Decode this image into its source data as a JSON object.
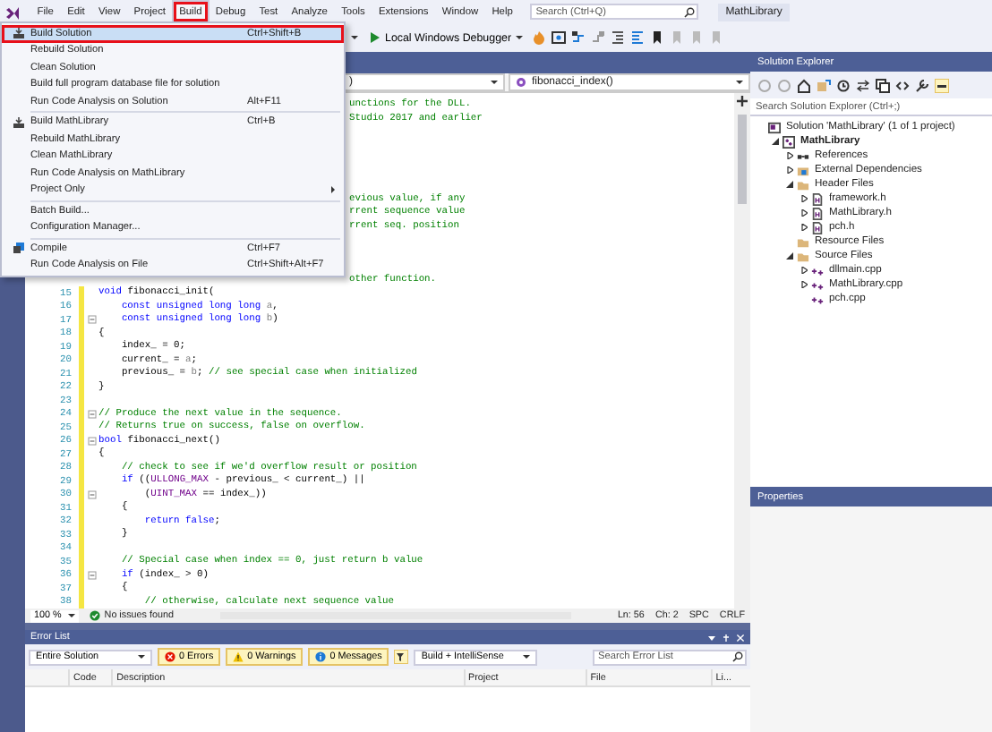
{
  "menu_bar": {
    "items": [
      {
        "label": "File",
        "selected": false,
        "highlighted": false
      },
      {
        "label": "Edit",
        "selected": false,
        "highlighted": false
      },
      {
        "label": "View",
        "selected": false,
        "highlighted": false
      },
      {
        "label": "Project",
        "selected": false,
        "highlighted": false
      },
      {
        "label": "Build",
        "selected": true,
        "highlighted": true
      },
      {
        "label": "Debug",
        "selected": false,
        "highlighted": false
      },
      {
        "label": "Test",
        "selected": false,
        "highlighted": false
      },
      {
        "label": "Analyze",
        "selected": false,
        "highlighted": false
      },
      {
        "label": "Tools",
        "selected": false,
        "highlighted": false
      },
      {
        "label": "Extensions",
        "selected": false,
        "highlighted": false
      },
      {
        "label": "Window",
        "selected": false,
        "highlighted": false
      },
      {
        "label": "Help",
        "selected": false,
        "highlighted": false
      }
    ],
    "search": {
      "placeholder": "Search (Ctrl+Q)"
    },
    "solution_name": "MathLibrary"
  },
  "toolbar": {
    "debugger": "Local Windows Debugger"
  },
  "build_menu": {
    "groups": [
      [
        {
          "kind": "build",
          "label": "Build Solution",
          "shortcut": "Ctrl+Shift+B",
          "selected": true,
          "highlighted": true,
          "submenu": false
        },
        {
          "kind": "plain",
          "label": "Rebuild Solution",
          "selected": false,
          "highlighted": false,
          "submenu": false
        },
        {
          "kind": "plain",
          "label": "Clean Solution",
          "selected": false,
          "highlighted": false,
          "submenu": false
        },
        {
          "kind": "plain",
          "label": "Build full program database file for solution",
          "selected": false,
          "highlighted": false,
          "submenu": false
        },
        {
          "kind": "plain",
          "label": "Run Code Analysis on Solution",
          "shortcut": "Alt+F11",
          "selected": false,
          "highlighted": false,
          "submenu": false
        }
      ],
      [
        {
          "kind": "build",
          "label": "Build MathLibrary",
          "shortcut": "Ctrl+B",
          "selected": false,
          "highlighted": false,
          "submenu": false
        },
        {
          "kind": "plain",
          "label": "Rebuild MathLibrary",
          "selected": false,
          "highlighted": false,
          "submenu": false
        },
        {
          "kind": "plain",
          "label": "Clean MathLibrary",
          "selected": false,
          "highlighted": false,
          "submenu": false
        },
        {
          "kind": "plain",
          "label": "Run Code Analysis on MathLibrary",
          "selected": false,
          "highlighted": false,
          "submenu": false
        },
        {
          "kind": "plain",
          "label": "Project Only",
          "selected": false,
          "highlighted": false,
          "submenu": true
        }
      ],
      [
        {
          "kind": "plain",
          "label": "Batch Build...",
          "selected": false,
          "highlighted": false,
          "submenu": false
        },
        {
          "kind": "plain",
          "label": "Configuration Manager...",
          "selected": false,
          "highlighted": false,
          "submenu": false
        }
      ],
      [
        {
          "kind": "compile",
          "label": "Compile",
          "shortcut": "Ctrl+F7",
          "selected": false,
          "highlighted": false,
          "submenu": false
        },
        {
          "kind": "plain",
          "label": "Run Code Analysis on File",
          "shortcut": "Ctrl+Shift+Alt+F7",
          "selected": false,
          "highlighted": false,
          "submenu": false
        }
      ]
    ]
  },
  "editor": {
    "nav_left": ")",
    "nav_right": "fibonacci_index()",
    "lines": [
      {
        "kind": "covered",
        "parts": [
          {
            "kind": "comment",
            "text": "unctions for the DLL."
          }
        ]
      },
      {
        "kind": "covered",
        "parts": [
          {
            "kind": "comment",
            "text": "Studio 2017 and earlier"
          }
        ]
      },
      {
        "kind": "covered"
      },
      {
        "kind": "covered"
      },
      {
        "kind": "covered"
      },
      {
        "kind": "covered"
      },
      {
        "kind": "covered"
      },
      {
        "kind": "covered",
        "parts": [
          {
            "kind": "comment",
            "text": "evious value, if any"
          }
        ]
      },
      {
        "kind": "covered",
        "parts": [
          {
            "kind": "comment",
            "text": "rrent sequence value"
          }
        ]
      },
      {
        "kind": "covered",
        "parts": [
          {
            "kind": "comment",
            "text": "rrent seq. position"
          }
        ]
      },
      {
        "kind": "covered"
      },
      {
        "kind": "covered"
      },
      {
        "kind": "covered"
      },
      {
        "kind": "covered",
        "parts": [
          {
            "kind": "comment",
            "text": "other function."
          }
        ]
      },
      {
        "kind": "code",
        "number": "15",
        "changed": true,
        "fold": false,
        "parts": [
          {
            "kind": "keyword",
            "text": "void"
          },
          {
            "kind": "plain",
            "text": " fibonacci_init("
          }
        ]
      },
      {
        "kind": "code",
        "number": "16",
        "changed": true,
        "fold": false,
        "parts": [
          {
            "kind": "keyword",
            "text": "    const unsigned long long"
          },
          {
            "kind": "parameter",
            "text": " a"
          },
          {
            "kind": "plain",
            "text": ","
          }
        ]
      },
      {
        "kind": "code",
        "number": "17",
        "changed": true,
        "fold": true,
        "parts": [
          {
            "kind": "keyword",
            "text": "    const unsigned long long"
          },
          {
            "kind": "parameter",
            "text": " b"
          },
          {
            "kind": "plain",
            "text": ")"
          }
        ]
      },
      {
        "kind": "code",
        "number": "18",
        "changed": true,
        "fold": false,
        "parts": [
          {
            "kind": "plain",
            "text": "{"
          }
        ]
      },
      {
        "kind": "code",
        "number": "19",
        "changed": true,
        "fold": false,
        "parts": [
          {
            "kind": "plain",
            "text": "    index_ = 0;"
          }
        ]
      },
      {
        "kind": "code",
        "number": "20",
        "changed": true,
        "fold": false,
        "parts": [
          {
            "kind": "plain",
            "text": "    current_ = "
          },
          {
            "kind": "parameter",
            "text": "a"
          },
          {
            "kind": "plain",
            "text": ";"
          }
        ]
      },
      {
        "kind": "code",
        "number": "21",
        "changed": true,
        "fold": false,
        "parts": [
          {
            "kind": "plain",
            "text": "    previous_ = "
          },
          {
            "kind": "parameter",
            "text": "b"
          },
          {
            "kind": "plain",
            "text": "; "
          },
          {
            "kind": "comment",
            "text": "// see special case when initialized"
          }
        ]
      },
      {
        "kind": "code",
        "number": "22",
        "changed": true,
        "fold": false,
        "parts": [
          {
            "kind": "plain",
            "text": "}"
          }
        ]
      },
      {
        "kind": "code",
        "number": "23",
        "changed": true,
        "fold": false
      },
      {
        "kind": "code",
        "number": "24",
        "changed": true,
        "fold": true,
        "parts": [
          {
            "kind": "comment",
            "text": "// Produce the next value in the sequence."
          }
        ]
      },
      {
        "kind": "code",
        "number": "25",
        "changed": true,
        "fold": false,
        "parts": [
          {
            "kind": "comment",
            "text": "// Returns true on success, false on overflow."
          }
        ]
      },
      {
        "kind": "code",
        "number": "26",
        "changed": true,
        "fold": true,
        "parts": [
          {
            "kind": "keyword",
            "text": "bool"
          },
          {
            "kind": "plain",
            "text": " fibonacci_next()"
          }
        ]
      },
      {
        "kind": "code",
        "number": "27",
        "changed": true,
        "fold": false,
        "parts": [
          {
            "kind": "plain",
            "text": "{"
          }
        ]
      },
      {
        "kind": "code",
        "number": "28",
        "changed": true,
        "fold": false,
        "parts": [
          {
            "kind": "comment",
            "text": "    // check to see if we'd overflow result or position"
          }
        ]
      },
      {
        "kind": "code",
        "number": "29",
        "changed": true,
        "fold": false,
        "parts": [
          {
            "kind": "keyword",
            "text": "    if"
          },
          {
            "kind": "plain",
            "text": " (("
          },
          {
            "kind": "macro",
            "text": "ULLONG_MAX"
          },
          {
            "kind": "plain",
            "text": " - previous_ < current_) ||"
          }
        ]
      },
      {
        "kind": "code",
        "number": "30",
        "changed": true,
        "fold": true,
        "parts": [
          {
            "kind": "plain",
            "text": "        ("
          },
          {
            "kind": "macro",
            "text": "UINT_MAX"
          },
          {
            "kind": "plain",
            "text": " == index_))"
          }
        ]
      },
      {
        "kind": "code",
        "number": "31",
        "changed": true,
        "fold": false,
        "parts": [
          {
            "kind": "plain",
            "text": "    {"
          }
        ]
      },
      {
        "kind": "code",
        "number": "32",
        "changed": true,
        "fold": false,
        "parts": [
          {
            "kind": "keyword",
            "text": "        return false"
          },
          {
            "kind": "plain",
            "text": ";"
          }
        ]
      },
      {
        "kind": "code",
        "number": "33",
        "changed": true,
        "fold": false,
        "parts": [
          {
            "kind": "plain",
            "text": "    }"
          }
        ]
      },
      {
        "kind": "code",
        "number": "34",
        "changed": true,
        "fold": false
      },
      {
        "kind": "code",
        "number": "35",
        "changed": true,
        "fold": false,
        "parts": [
          {
            "kind": "comment",
            "text": "    // Special case when index == 0, just return b value"
          }
        ]
      },
      {
        "kind": "code",
        "number": "36",
        "changed": true,
        "fold": true,
        "parts": [
          {
            "kind": "keyword",
            "text": "    if"
          },
          {
            "kind": "plain",
            "text": " (index_ > 0)"
          }
        ]
      },
      {
        "kind": "code",
        "number": "37",
        "changed": true,
        "fold": false,
        "parts": [
          {
            "kind": "plain",
            "text": "    {"
          }
        ]
      },
      {
        "kind": "code",
        "number": "38",
        "changed": true,
        "fold": false,
        "parts": [
          {
            "kind": "comment",
            "text": "        // otherwise, calculate next sequence value"
          }
        ]
      }
    ],
    "status": {
      "zoom": "100 %",
      "issues": "No issues found",
      "line": "Ln: 56",
      "column": "Ch: 2",
      "spacing": "SPC",
      "line_ending": "CRLF"
    }
  },
  "error_list": {
    "title": "Error List",
    "scope": "Entire Solution",
    "filters": [
      {
        "kind": "error",
        "label": "0 Errors",
        "selected": true
      },
      {
        "kind": "warning",
        "label": "0 Warnings",
        "selected": true
      },
      {
        "kind": "message",
        "label": "0 Messages",
        "selected": true
      }
    ],
    "source": "Build + IntelliSense",
    "search": {
      "placeholder": "Search Error List"
    },
    "columns": [
      "Code",
      "Description",
      "Project",
      "File",
      "Li..."
    ]
  },
  "solution_explorer": {
    "title": "Solution Explorer",
    "search": {
      "placeholder": "Search Solution Explorer (Ctrl+;)"
    },
    "tree": [
      {
        "label": "Solution 'MathLibrary' (1 of 1 project)",
        "kind": "solution",
        "children": [
          {
            "label": "MathLibrary",
            "kind": "project",
            "expanded": true,
            "children": [
              {
                "label": "References",
                "kind": "references",
                "expanded": false
              },
              {
                "label": "External Dependencies",
                "kind": "dependencies",
                "expanded": false
              },
              {
                "label": "Header Files",
                "kind": "folder",
                "expanded": true,
                "children": [
                  {
                    "label": "framework.h",
                    "kind": "header",
                    "expanded": false
                  },
                  {
                    "label": "MathLibrary.h",
                    "kind": "header",
                    "expanded": false
                  },
                  {
                    "label": "pch.h",
                    "kind": "header",
                    "expanded": false
                  }
                ]
              },
              {
                "label": "Resource Files",
                "kind": "folder"
              },
              {
                "label": "Source Files",
                "kind": "folder",
                "expanded": true,
                "children": [
                  {
                    "label": "dllmain.cpp",
                    "kind": "source",
                    "expanded": false
                  },
                  {
                    "label": "MathLibrary.cpp",
                    "kind": "source",
                    "expanded": false
                  },
                  {
                    "label": "pch.cpp",
                    "kind": "source"
                  }
                ]
              }
            ]
          }
        ]
      }
    ]
  },
  "properties": {
    "title": "Properties"
  }
}
